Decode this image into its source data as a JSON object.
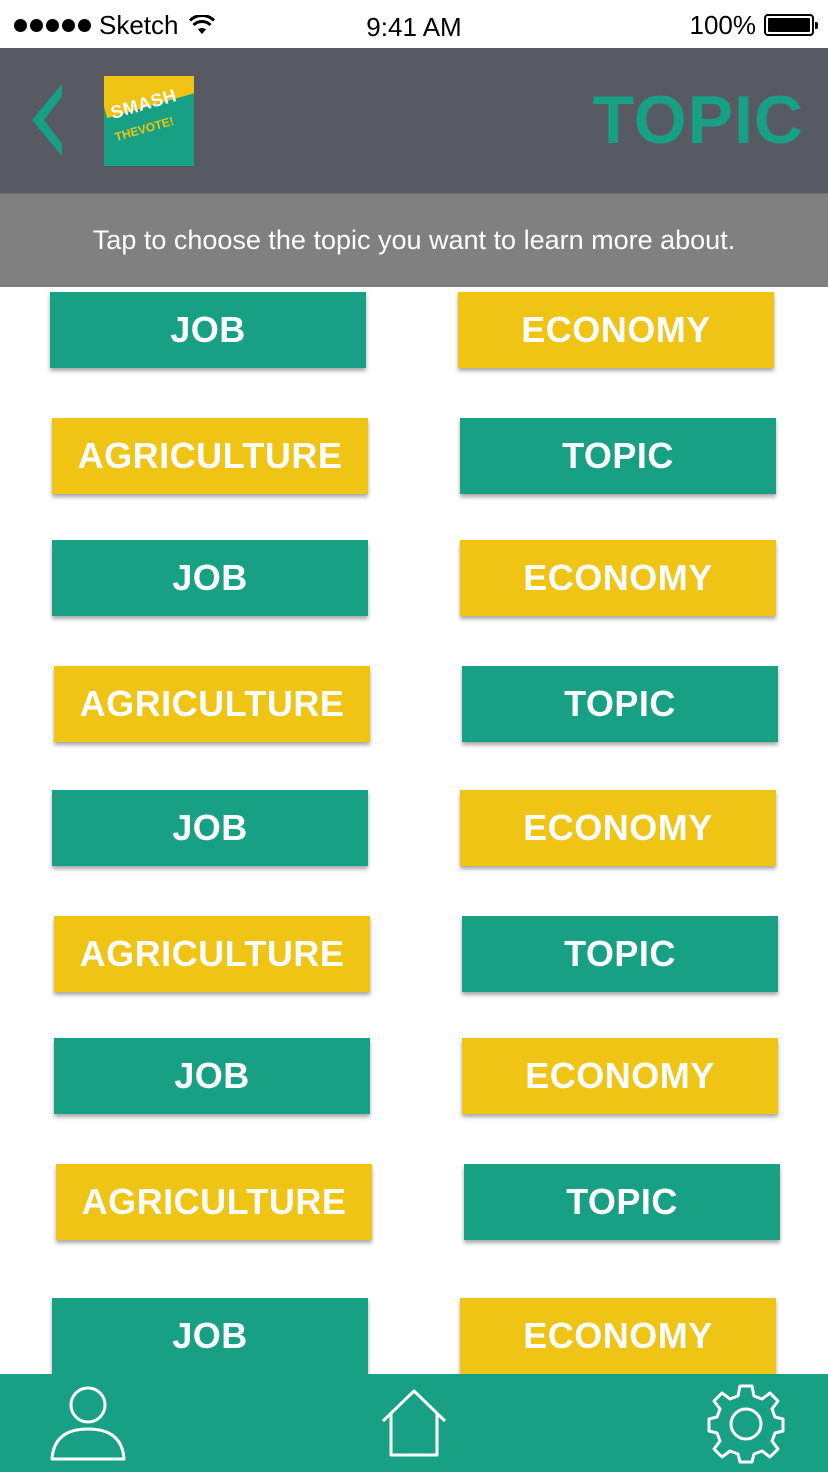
{
  "status_bar": {
    "carrier": "Sketch",
    "time": "9:41 AM",
    "battery": "100%"
  },
  "header": {
    "logo_line1": "SMASH",
    "logo_line2": "THEVOTE!",
    "title": "TOPIC"
  },
  "instruction": "Tap to choose the topic you want to learn more about.",
  "topics": [
    "JOB",
    "ECONOMY",
    "AGRICULTURE",
    "TOPIC",
    "JOB",
    "ECONOMY",
    "AGRICULTURE",
    "TOPIC",
    "JOB",
    "ECONOMY",
    "AGRICULTURE",
    "TOPIC",
    "JOB",
    "ECONOMY",
    "AGRICULTURE",
    "TOPIC",
    "JOB",
    "ECONOMY"
  ],
  "colors": {
    "teal": "#17a084",
    "yellow": "#f0c414",
    "header": "#575a63",
    "banner": "#808080"
  },
  "tab_bar": {
    "items": [
      "profile-icon",
      "home-icon",
      "settings-icon"
    ]
  }
}
